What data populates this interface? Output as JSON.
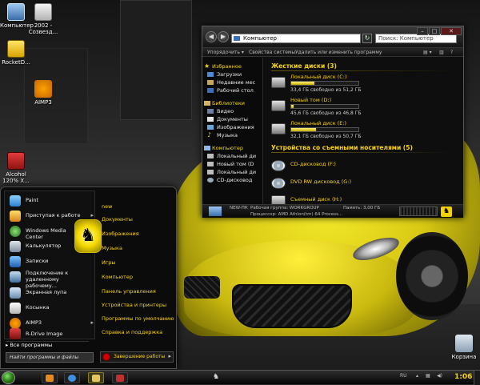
{
  "desktop_icons": [
    {
      "label": "Компьютер",
      "icon": "computer-icon"
    },
    {
      "label": "2002 - Созвезд...",
      "icon": "document-icon"
    },
    {
      "label": "RocketD...",
      "icon": "rocketdock-icon"
    },
    {
      "label": "AIMP3",
      "icon": "aimp-icon"
    },
    {
      "label": "Alcohol 120% X...",
      "icon": "alcohol-icon"
    },
    {
      "label": "Корзина",
      "icon": "recycle-bin-icon"
    }
  ],
  "explorer": {
    "address": "Компьютер",
    "search_placeholder": "Поиск: Компьютер",
    "toolbar": [
      "Упорядочить ▾",
      "Свойства системы",
      "Удалить или изменить программу"
    ],
    "nav": {
      "favorites_head": "Избранное",
      "favorites": [
        "Загрузки",
        "Недавние мес",
        "Рабочий стол"
      ],
      "libraries_head": "Библиотеки",
      "libraries": [
        "Видео",
        "Документы",
        "Изображения",
        "Музыка"
      ],
      "computer_head": "Компьютер",
      "computer": [
        "Локальный ди",
        "Новый том (D",
        "Локальный ди",
        "CD-дисковод"
      ]
    },
    "hard_drives_head": "Жесткие диски (3)",
    "drives": [
      {
        "name": "Локальный диск (C:)",
        "free": "33,4 ГБ свободно из 51,2 ГБ",
        "used_fraction": 0.35
      },
      {
        "name": "Новый том (D:)",
        "free": "45,6 ГБ свободно из 46,8 ГБ",
        "used_fraction": 0.03
      },
      {
        "name": "Локальный диск (E:)",
        "free": "32,1 ГБ свободно из 50,7 ГБ",
        "used_fraction": 0.37
      }
    ],
    "removable_head": "Устройства со съемными носителями (5)",
    "removable": [
      {
        "name": "CD-дисковод (F:)"
      },
      {
        "name": "DVD RW дисковод (G:)"
      },
      {
        "name": "Съемный диск (H:)"
      }
    ],
    "status": {
      "pc_name": "NEW-ПК",
      "workgroup": "Рабочая группа: WORKGROUP",
      "memory": "Память: 3,00 ГБ",
      "cpu": "Процессор: AMD Athlon(tm) 64 Process..."
    }
  },
  "start_menu": {
    "programs": [
      {
        "label": "Paint",
        "arrow": "",
        "icon": "paint-icon"
      },
      {
        "label": "Приступая к работе",
        "arrow": "▸",
        "icon": "getting-started-icon"
      },
      {
        "label": "Windows Media Center",
        "arrow": "",
        "icon": "media-center-icon"
      },
      {
        "label": "Калькулятор",
        "arrow": "▸",
        "icon": "calculator-icon"
      },
      {
        "label": "Записки",
        "arrow": "",
        "icon": "sticky-notes-icon"
      },
      {
        "label": "Подключение к удаленному рабочему...",
        "arrow": "",
        "icon": "remote-desktop-icon"
      },
      {
        "label": "Экранная лупа",
        "arrow": "",
        "icon": "magnifier-icon"
      },
      {
        "label": "Косынка",
        "arrow": "",
        "icon": "solitaire-icon"
      },
      {
        "label": "AIMP3",
        "arrow": "▸",
        "icon": "aimp-icon"
      },
      {
        "label": "R-Drive Image",
        "arrow": "",
        "icon": "rdrive-icon"
      }
    ],
    "all_programs": "Все программы",
    "search_placeholder": "Найти программы и файлы",
    "right_links": [
      "new",
      "Документы",
      "Изображения",
      "Музыка",
      "Игры",
      "Компьютер",
      "Панель управления",
      "Устройства и принтеры",
      "Программы по умолчанию",
      "Справка и поддержка"
    ],
    "shutdown": "Завершение работы"
  },
  "taskbar": {
    "tray_lang": "RU",
    "clock": "1:06"
  }
}
